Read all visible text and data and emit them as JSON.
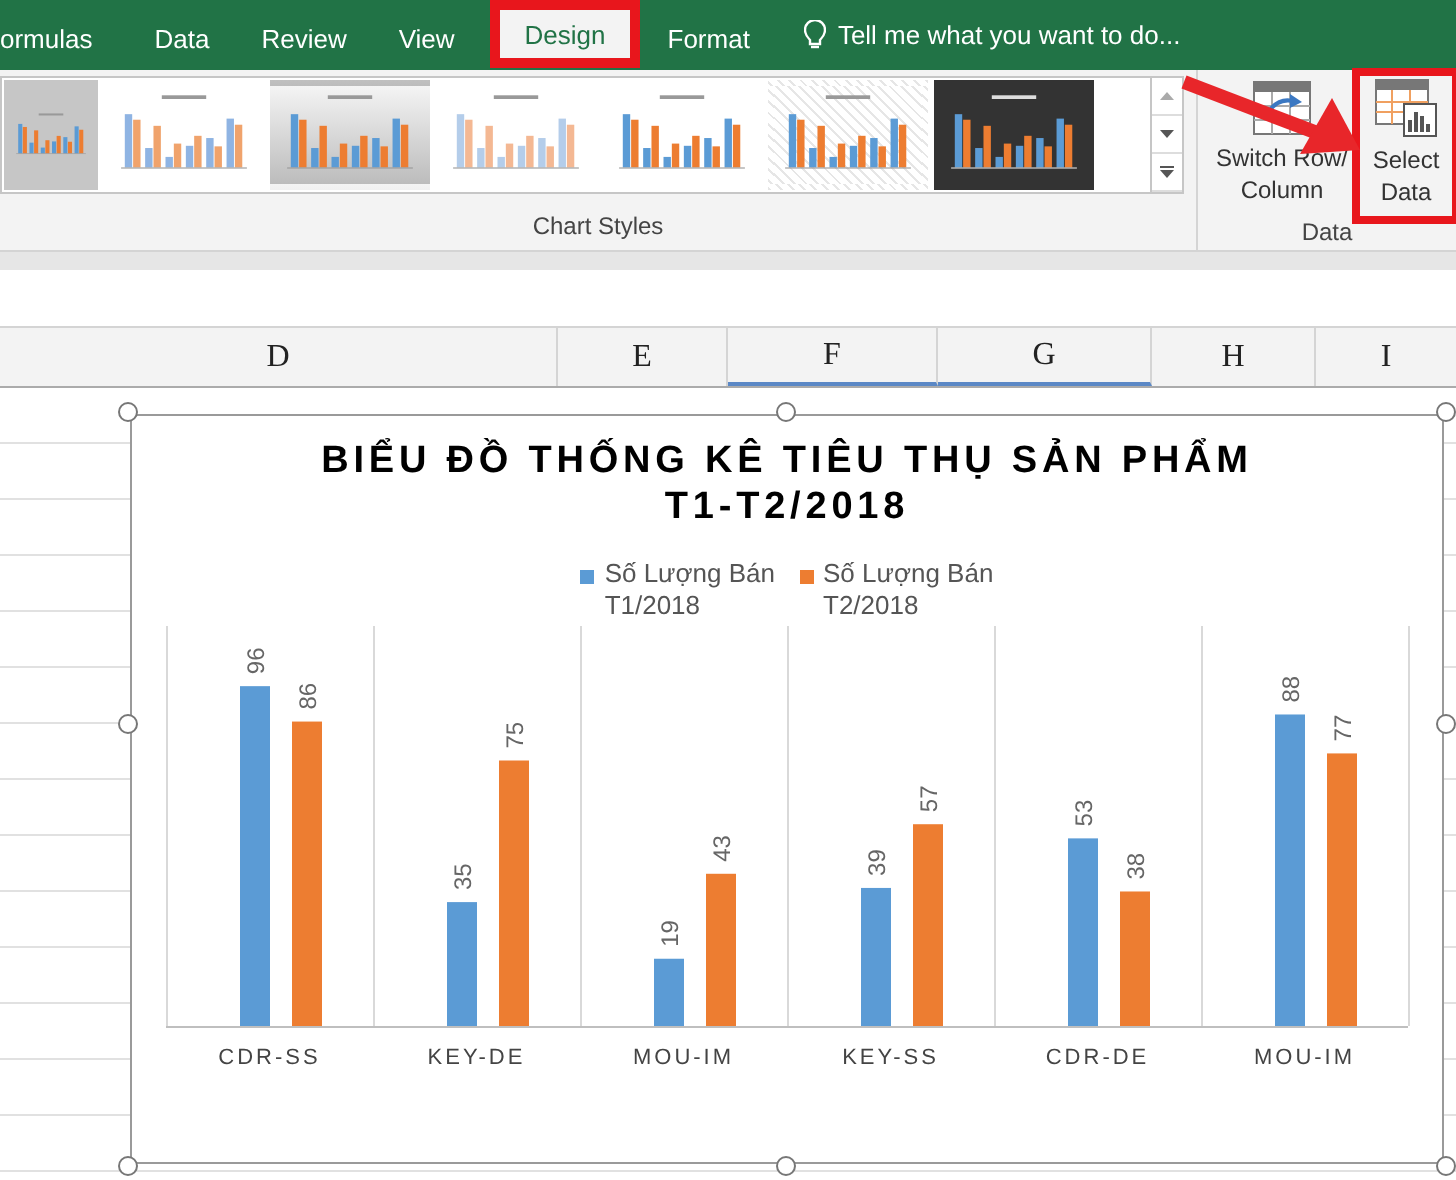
{
  "tabs": [
    {
      "label": "ormulas",
      "selected": false,
      "highlighted": false
    },
    {
      "label": "Data",
      "selected": false,
      "highlighted": false
    },
    {
      "label": "Review",
      "selected": false,
      "highlighted": false
    },
    {
      "label": "View",
      "selected": false,
      "highlighted": false
    },
    {
      "label": "Design",
      "selected": true,
      "highlighted": true
    },
    {
      "label": "Format",
      "selected": false,
      "highlighted": false
    }
  ],
  "tell_me": {
    "placeholder": "Tell me what you want to do..."
  },
  "chart_styles": {
    "label": "Chart Styles",
    "items": [
      {
        "kind": "plain",
        "selected": true
      },
      {
        "kind": "striped",
        "selected": false
      },
      {
        "kind": "shaded",
        "selected": false
      },
      {
        "kind": "light",
        "selected": false
      },
      {
        "kind": "plain",
        "selected": false
      },
      {
        "kind": "hatched",
        "selected": false
      },
      {
        "kind": "dark",
        "selected": false
      }
    ]
  },
  "data_group": {
    "label": "Data",
    "buttons": [
      {
        "kind": "switch",
        "label": "Switch Row/\nColumn",
        "highlighted": false
      },
      {
        "kind": "select",
        "label": "Select\nData",
        "highlighted": true
      }
    ]
  },
  "columns": [
    "D",
    "E",
    "F",
    "G",
    "H",
    "I"
  ],
  "chart": {
    "title": "BIỂU ĐỒ THỐNG KÊ TIÊU THỤ SẢN PHẨM\nT1-T2/2018",
    "chart_data": {
      "type": "bar",
      "categories": [
        "CDR-SS",
        "KEY-DE",
        "MOU-IM",
        "KEY-SS",
        "CDR-DE",
        "MOU-IM"
      ],
      "series": [
        {
          "name": "Số Lượng Bán\nT1/2018",
          "color": "#5b9bd5",
          "values": [
            96,
            35,
            19,
            39,
            53,
            88
          ]
        },
        {
          "name": "Số Lượng Bán\nT2/2018",
          "color": "#ed7d31",
          "values": [
            86,
            75,
            43,
            57,
            38,
            77
          ]
        }
      ],
      "data_labels": true
    }
  }
}
